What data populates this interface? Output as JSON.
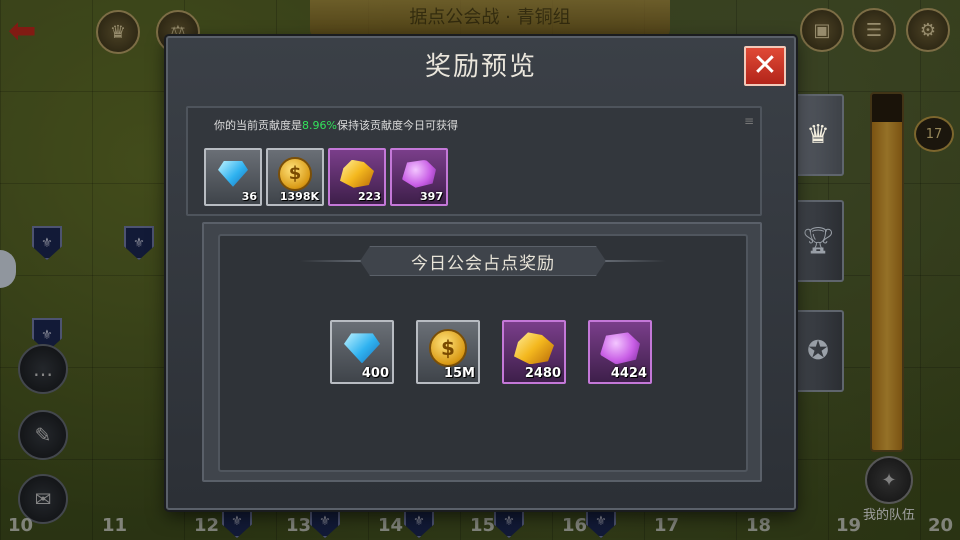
{
  "background": {
    "banner_title": "据点公会战 · 青铜组",
    "grid_numbers": [
      "10",
      "11",
      "12",
      "13",
      "14",
      "15",
      "16",
      "17",
      "18",
      "19",
      "20"
    ],
    "progress_level": "17",
    "progress_fraction": 0.92,
    "my_team_label": "我的队伍"
  },
  "dialog": {
    "title": "奖励预览",
    "close_icon": "close-x",
    "contribution": {
      "prefix": "你的当前贡献度是",
      "percent": "8.96%",
      "suffix": "保持该贡献度今日可获得"
    },
    "current_rewards": [
      {
        "icon": "diamond-icon",
        "qty": "36",
        "frame": "grey"
      },
      {
        "icon": "gold-coin-icon",
        "qty": "1398K",
        "frame": "grey"
      },
      {
        "icon": "gold-ore-icon",
        "qty": "223",
        "frame": "purple"
      },
      {
        "icon": "purple-ore-icon",
        "qty": "397",
        "frame": "purple"
      }
    ],
    "daily_section_title": "今日公会占点奖励",
    "daily_rewards": [
      {
        "icon": "diamond-icon",
        "qty": "400",
        "frame": "grey"
      },
      {
        "icon": "gold-coin-icon",
        "qty": "15M",
        "frame": "grey"
      },
      {
        "icon": "gold-ore-icon",
        "qty": "2480",
        "frame": "purple"
      },
      {
        "icon": "purple-ore-icon",
        "qty": "4424",
        "frame": "purple"
      }
    ]
  },
  "side_tabs": [
    {
      "icon": "crown-icon",
      "active": true
    },
    {
      "icon": "trophy-icon",
      "active": false
    },
    {
      "icon": "medal-icon",
      "active": false
    }
  ],
  "colors": {
    "percent_green": "#33e25b",
    "close_red": "#c8321f",
    "purple_frame": "#c478d8"
  }
}
